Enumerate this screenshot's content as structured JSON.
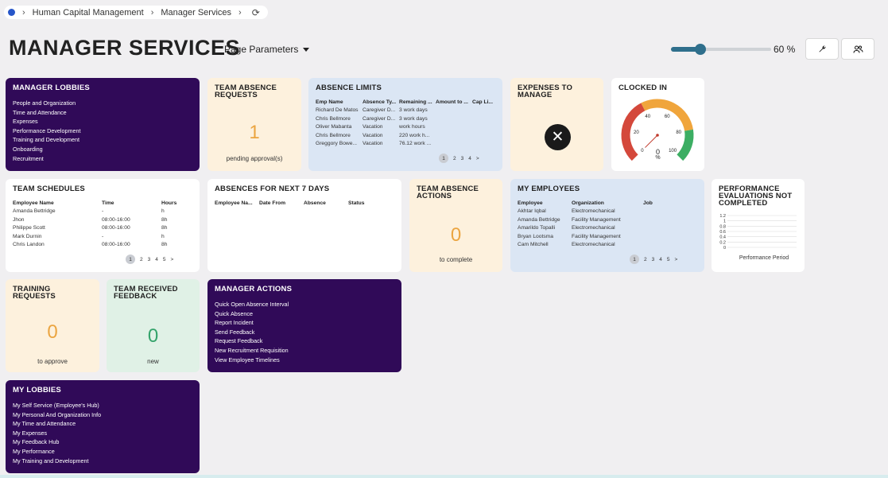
{
  "breadcrumb": [
    "Human Capital Management",
    "Manager Services"
  ],
  "page_title": "MANAGER SERVICES",
  "page_parameters_label": "Page Parameters",
  "zoom": {
    "value": 60,
    "label": "60 %"
  },
  "icons": {
    "tools": "wrench-icon",
    "people": "people-icon",
    "refresh": "refresh-icon"
  },
  "colors": {
    "purple": "#300a58",
    "orange": "#eba541",
    "green": "#34a36b",
    "gauge_red": "#d4483b",
    "gauge_orange": "#f0a53c",
    "gauge_green": "#3cae63"
  },
  "manager_lobbies": {
    "title": "MANAGER LOBBIES",
    "items": [
      "People and Organization",
      "Time and Attendance",
      "Expenses",
      "Performance Development",
      "Training and Development",
      "Onboarding",
      "Recruitment"
    ]
  },
  "team_absence_requests": {
    "title": "TEAM ABSENCE REQUESTS",
    "value": "1",
    "caption": "pending approval(s)"
  },
  "absence_limits": {
    "title": "ABSENCE LIMITS",
    "columns": [
      "Emp Name",
      "Absence Ty...",
      "Remaining ...",
      "Amount to ...",
      "Cap Li..."
    ],
    "rows": [
      [
        "Richard De Matos",
        "Caregiver D...",
        "3 work days",
        "",
        ""
      ],
      [
        "Chris Bellmore",
        "Caregiver D...",
        "3 work days",
        "",
        ""
      ],
      [
        "Oliver Mabanta",
        "Vacation",
        "work hours",
        "",
        ""
      ],
      [
        "Chris Bellmore",
        "Vacation",
        "220 work h...",
        "",
        ""
      ],
      [
        "Greggory Bowe...",
        "Vacation",
        "76.12 work ...",
        "",
        ""
      ]
    ],
    "pager": [
      "1",
      "2",
      "3",
      "4",
      ">"
    ]
  },
  "expenses_to_manage": {
    "title": "EXPENSES TO MANAGE",
    "icon": "close-circle-icon"
  },
  "clocked_in": {
    "title": "CLOCKED IN",
    "ticks": [
      "0",
      "20",
      "40",
      "60",
      "80",
      "100"
    ],
    "value": "0",
    "unit": "%",
    "gauge_value": 0
  },
  "team_schedules": {
    "title": "TEAM SCHEDULES",
    "columns": [
      "Employee Name",
      "Time",
      "Hours"
    ],
    "rows": [
      [
        "Amanda Bettridge",
        "-",
        "h"
      ],
      [
        "Jhon",
        "08:00-16:00",
        "8h"
      ],
      [
        "Philippe Scott",
        "08:00-16:00",
        "8h"
      ],
      [
        "Mark Durnin",
        "-",
        "h"
      ],
      [
        "Chris Landon",
        "08:00-16:00",
        "8h"
      ]
    ],
    "pager": [
      "1",
      "2",
      "3",
      "4",
      "5",
      ">"
    ]
  },
  "absences_next_7": {
    "title": "ABSENCES FOR NEXT 7 DAYS",
    "columns": [
      "Employee Na...",
      "Date From",
      "Absence",
      "Status"
    ]
  },
  "team_absence_actions": {
    "title": "TEAM ABSENCE ACTIONS",
    "value": "0",
    "caption": "to complete"
  },
  "my_employees": {
    "title": "MY EMPLOYEES",
    "columns": [
      "Employee",
      "Organization",
      "Job"
    ],
    "rows": [
      [
        "Akhtar Iqbal",
        "Electromechanical",
        ""
      ],
      [
        "Amanda Bettridge",
        "Facility Management",
        ""
      ],
      [
        "Amarildo Topalli",
        "Electromechanical",
        ""
      ],
      [
        "Bryan Lootsma",
        "Facility Management",
        ""
      ],
      [
        "Cam Mitchell",
        "Electromechanical",
        ""
      ]
    ],
    "pager": [
      "1",
      "2",
      "3",
      "4",
      "5",
      ">"
    ]
  },
  "performance_evaluations": {
    "title": "PERFORMANCE EVALUATIONS NOT COMPLETED",
    "chart_data": {
      "type": "bar",
      "categories": [],
      "values": [],
      "ylim": [
        0,
        1.2
      ],
      "yticks": [
        "1.2",
        "1",
        "0.8",
        "0.6",
        "0.4",
        "0.2",
        "0"
      ],
      "xlabel": "Performance Period",
      "grid": true
    }
  },
  "training_requests": {
    "title": "TRAINING REQUESTS",
    "value": "0",
    "caption": "to approve"
  },
  "team_received_feedback": {
    "title": "TEAM RECEIVED FEEDBACK",
    "value": "0",
    "caption": "new"
  },
  "manager_actions": {
    "title": "MANAGER ACTIONS",
    "items": [
      "Quick Open Absence Interval",
      "Quick Absence",
      "Report Incident",
      "Send Feedback",
      "Request Feedback",
      "New Recruitment Requisition",
      "View Employee Timelines"
    ]
  },
  "my_lobbies": {
    "title": "MY LOBBIES",
    "items": [
      "My Self Service (Employee's Hub)",
      "My Personal And Organization Info",
      "My Time and Attendance",
      "My Expenses",
      "My Feedback Hub",
      "My Performance",
      "My Training and Development"
    ]
  }
}
